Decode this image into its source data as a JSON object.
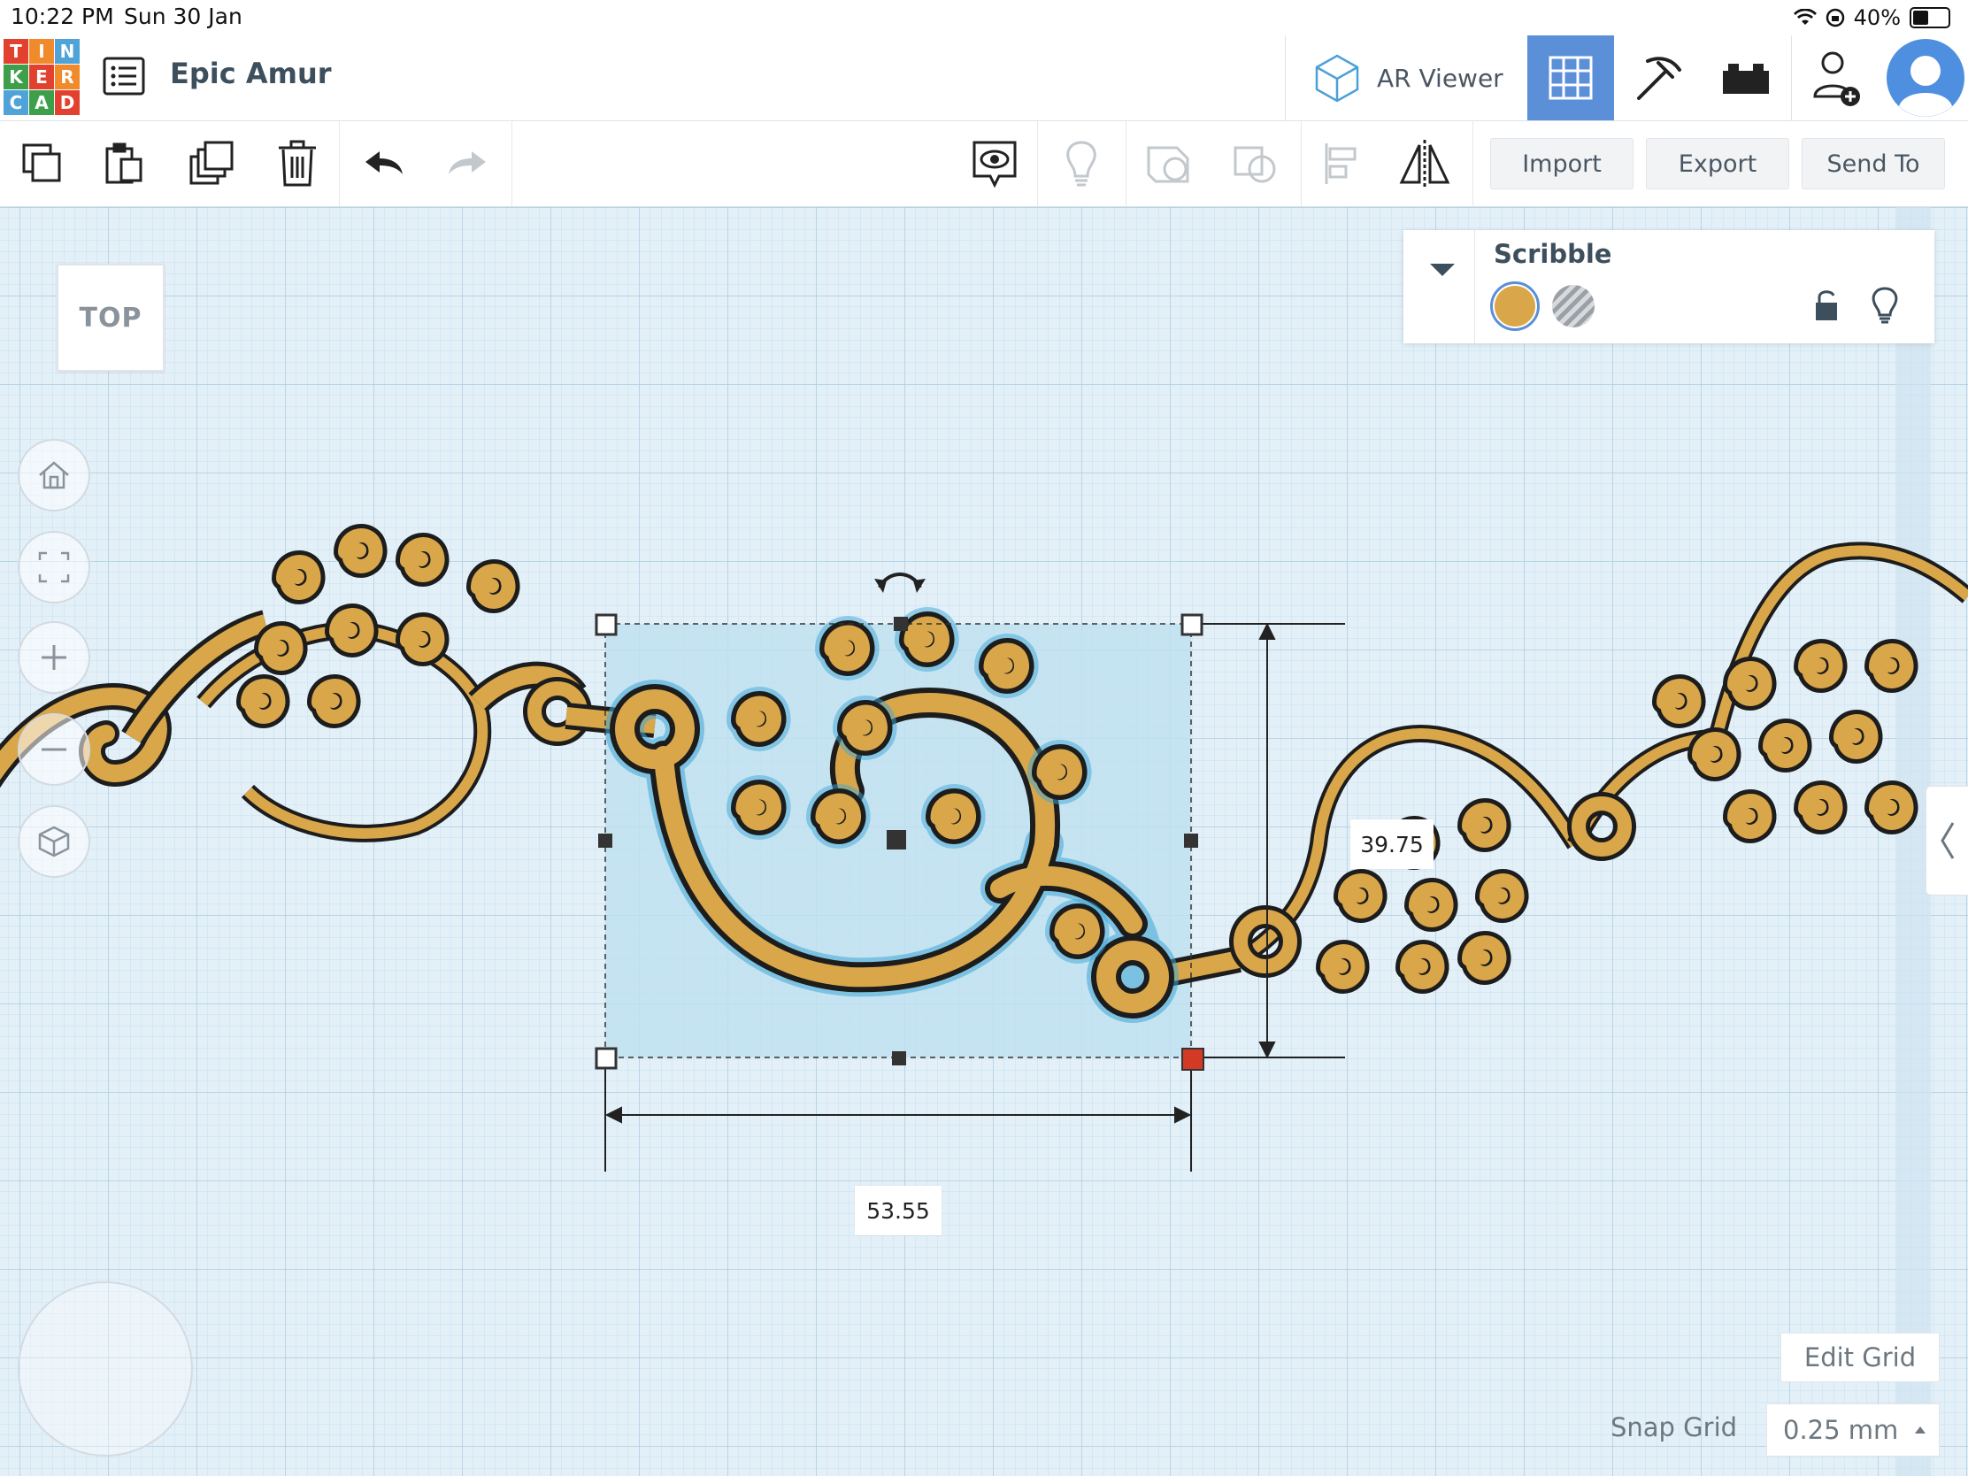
{
  "status_bar": {
    "time": "10:22 PM",
    "date": "Sun 30 Jan",
    "battery": "40%",
    "battery_level": 0.4,
    "icons": [
      "wifi-icon",
      "orientation-lock-icon",
      "battery-icon"
    ]
  },
  "app": {
    "logo_letters": [
      "T",
      "I",
      "N",
      "K",
      "E",
      "R",
      "C",
      "A",
      "D"
    ],
    "logo_colors": [
      "#e1412e",
      "#f18a2b",
      "#4fa3d9",
      "#3e9f4a",
      "#e1412e",
      "#f18a2b",
      "#4fa3d9",
      "#3e9f4a",
      "#e1412e"
    ],
    "project_title": "Epic Amur"
  },
  "header": {
    "ar_viewer_label": "AR Viewer",
    "tiles": [
      {
        "name": "3d-design-view",
        "icon": "grid-icon",
        "active": true
      },
      {
        "name": "blocks-view",
        "icon": "pickaxe-icon",
        "active": false
      },
      {
        "name": "bricks-view",
        "icon": "brick-icon",
        "active": false
      },
      {
        "name": "share-view",
        "icon": "add-user-icon",
        "active": false
      }
    ],
    "active_color": "#5b8fd8"
  },
  "toolbar": {
    "left_icons": [
      "copy-icon",
      "paste-icon",
      "duplicate-icon",
      "trash-icon",
      "undo-icon",
      "redo-icon"
    ],
    "right_icons": [
      "notes-visibility-icon",
      "lightbulb-icon",
      "group-icon",
      "ungroup-icon",
      "align-icon",
      "mirror-icon"
    ],
    "import_label": "Import",
    "export_label": "Export",
    "send_to_label": "Send To"
  },
  "viewport": {
    "view_cube_label": "TOP",
    "nav_icons": [
      "home-icon",
      "fit-view-icon",
      "zoom-in-icon",
      "zoom-out-icon",
      "perspective-icon"
    ],
    "grid_color": "#dcecf5"
  },
  "inspector": {
    "shape_name": "Scribble",
    "solid_color": "#d9a74a",
    "selected_mode": "solid"
  },
  "dimensions": {
    "width": "53.55",
    "height": "39.75"
  },
  "grid_controls": {
    "edit_grid_label": "Edit Grid",
    "snap_grid_label": "Snap Grid",
    "snap_grid_value": "0.25 mm"
  },
  "colors": {
    "shape_fill": "#d9a74a",
    "shape_outline": "#1d1d1d",
    "selection_fill": "#bfe1f0",
    "selection_glow": "#3fa7d6",
    "handle_active": "#d23a26"
  }
}
